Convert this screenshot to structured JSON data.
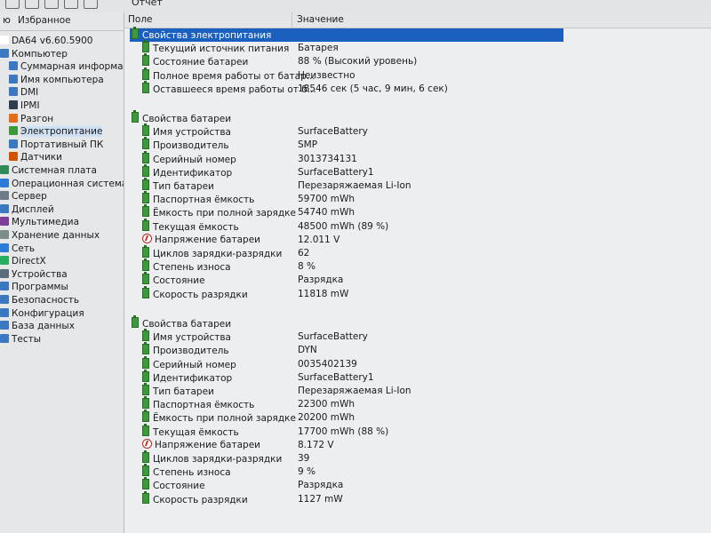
{
  "topbar": {
    "report_label": "Отчет"
  },
  "left_panel": {
    "menu_tab": "ю",
    "favorites_tab": "Избранное",
    "tree": [
      {
        "label": "DA64 v6.60.5900",
        "icon": "app-icon",
        "color": "#ffffff",
        "indent": 0
      },
      {
        "label": "Компьютер",
        "icon": "computer-icon",
        "color": "#3a78c2",
        "indent": 0
      },
      {
        "label": "Суммарная информация",
        "icon": "summary-icon",
        "color": "#3a78c2",
        "indent": 1
      },
      {
        "label": "Имя компьютера",
        "icon": "computer-name-icon",
        "color": "#3a78c2",
        "indent": 1
      },
      {
        "label": "DMI",
        "icon": "dmi-icon",
        "color": "#3a78c2",
        "indent": 1
      },
      {
        "label": "IPMI",
        "icon": "ipmi-icon",
        "color": "#2c3e50",
        "indent": 1
      },
      {
        "label": "Разгон",
        "icon": "flame-icon",
        "color": "#e26d1a",
        "indent": 1
      },
      {
        "label": "Электропитание",
        "icon": "battery-icon",
        "color": "#3d9a3b",
        "indent": 1,
        "selected": true
      },
      {
        "label": "Портативный ПК",
        "icon": "laptop-icon",
        "color": "#3a78c2",
        "indent": 1
      },
      {
        "label": "Датчики",
        "icon": "sensor-icon",
        "color": "#d35400",
        "indent": 1
      },
      {
        "label": "Системная плата",
        "icon": "motherboard-icon",
        "color": "#2e8b57",
        "indent": 0
      },
      {
        "label": "Операционная система",
        "icon": "windows-icon",
        "color": "#2b7bd8",
        "indent": 0
      },
      {
        "label": "Сервер",
        "icon": "server-icon",
        "color": "#6c7a89",
        "indent": 0
      },
      {
        "label": "Дисплей",
        "icon": "display-icon",
        "color": "#3a78c2",
        "indent": 0
      },
      {
        "label": "Мультимедиа",
        "icon": "multimedia-icon",
        "color": "#7d3c98",
        "indent": 0
      },
      {
        "label": "Хранение данных",
        "icon": "storage-icon",
        "color": "#7f8c8d",
        "indent": 0
      },
      {
        "label": "Сеть",
        "icon": "network-icon",
        "color": "#2b7bd8",
        "indent": 0
      },
      {
        "label": "DirectX",
        "icon": "directx-icon",
        "color": "#27ae60",
        "indent": 0
      },
      {
        "label": "Устройства",
        "icon": "devices-icon",
        "color": "#5d6d7e",
        "indent": 0
      },
      {
        "label": "Программы",
        "icon": "programs-icon",
        "color": "#3a78c2",
        "indent": 0
      },
      {
        "label": "Безопасность",
        "icon": "security-icon",
        "color": "#3a78c2",
        "indent": 0
      },
      {
        "label": "Конфигурация",
        "icon": "config-icon",
        "color": "#3a78c2",
        "indent": 0
      },
      {
        "label": "База данных",
        "icon": "database-icon",
        "color": "#3a78c2",
        "indent": 0
      },
      {
        "label": "Тесты",
        "icon": "tests-icon",
        "color": "#3a78c2",
        "indent": 0
      }
    ]
  },
  "columns": {
    "field": "Поле",
    "value": "Значение"
  },
  "sections": [
    {
      "title": "Свойства электропитания",
      "selected": true,
      "rows": [
        {
          "field": "Текущий источник питания",
          "value": "Батарея",
          "icon": "battery-icon"
        },
        {
          "field": "Состояние батареи",
          "value": "88 % (Высокий уровень)",
          "icon": "battery-icon"
        },
        {
          "field": "Полное время работы от батар...",
          "value": "Неизвестно",
          "icon": "battery-icon"
        },
        {
          "field": "Оставшееся время работы от б...",
          "value": "18546 сек (5 час, 9 мин, 6 сек)",
          "icon": "battery-icon"
        }
      ]
    },
    {
      "title": "Свойства батареи",
      "rows": [
        {
          "field": "Имя устройства",
          "value": "SurfaceBattery",
          "icon": "battery-icon"
        },
        {
          "field": "Производитель",
          "value": "SMP",
          "icon": "battery-icon"
        },
        {
          "field": "Серийный номер",
          "value": "3013734131",
          "icon": "battery-icon"
        },
        {
          "field": "Идентификатор",
          "value": "SurfaceBattery1",
          "icon": "battery-icon"
        },
        {
          "field": "Тип батареи",
          "value": "Перезаряжаемая Li-Ion",
          "icon": "battery-icon"
        },
        {
          "field": "Паспортная ёмкость",
          "value": "59700 mWh",
          "icon": "battery-icon"
        },
        {
          "field": "Ёмкость при полной зарядке",
          "value": "54740 mWh",
          "icon": "battery-icon"
        },
        {
          "field": "Текущая ёмкость",
          "value": "48500 mWh  (89 %)",
          "icon": "battery-icon"
        },
        {
          "field": "Напряжение батареи",
          "value": "12.011 V",
          "icon": "voltage-icon"
        },
        {
          "field": "Циклов зарядки-разрядки",
          "value": "62",
          "icon": "battery-icon"
        },
        {
          "field": "Степень износа",
          "value": "8 %",
          "icon": "battery-icon"
        },
        {
          "field": "Состояние",
          "value": "Разрядка",
          "icon": "battery-icon"
        },
        {
          "field": "Скорость разрядки",
          "value": "11818 mW",
          "icon": "battery-icon"
        }
      ]
    },
    {
      "title": "Свойства батареи",
      "rows": [
        {
          "field": "Имя устройства",
          "value": "SurfaceBattery",
          "icon": "battery-icon"
        },
        {
          "field": "Производитель",
          "value": "DYN",
          "icon": "battery-icon"
        },
        {
          "field": "Серийный номер",
          "value": "0035402139",
          "icon": "battery-icon"
        },
        {
          "field": "Идентификатор",
          "value": "SurfaceBattery1",
          "icon": "battery-icon"
        },
        {
          "field": "Тип батареи",
          "value": "Перезаряжаемая Li-Ion",
          "icon": "battery-icon"
        },
        {
          "field": "Паспортная ёмкость",
          "value": "22300 mWh",
          "icon": "battery-icon"
        },
        {
          "field": "Ёмкость при полной зарядке",
          "value": "20200 mWh",
          "icon": "battery-icon"
        },
        {
          "field": "Текущая ёмкость",
          "value": "17700 mWh  (88 %)",
          "icon": "battery-icon"
        },
        {
          "field": "Напряжение батареи",
          "value": "8.172 V",
          "icon": "voltage-icon"
        },
        {
          "field": "Циклов зарядки-разрядки",
          "value": "39",
          "icon": "battery-icon"
        },
        {
          "field": "Степень износа",
          "value": "9 %",
          "icon": "battery-icon"
        },
        {
          "field": "Состояние",
          "value": "Разрядка",
          "icon": "battery-icon"
        },
        {
          "field": "Скорость разрядки",
          "value": "1127 mW",
          "icon": "battery-icon"
        }
      ]
    }
  ]
}
